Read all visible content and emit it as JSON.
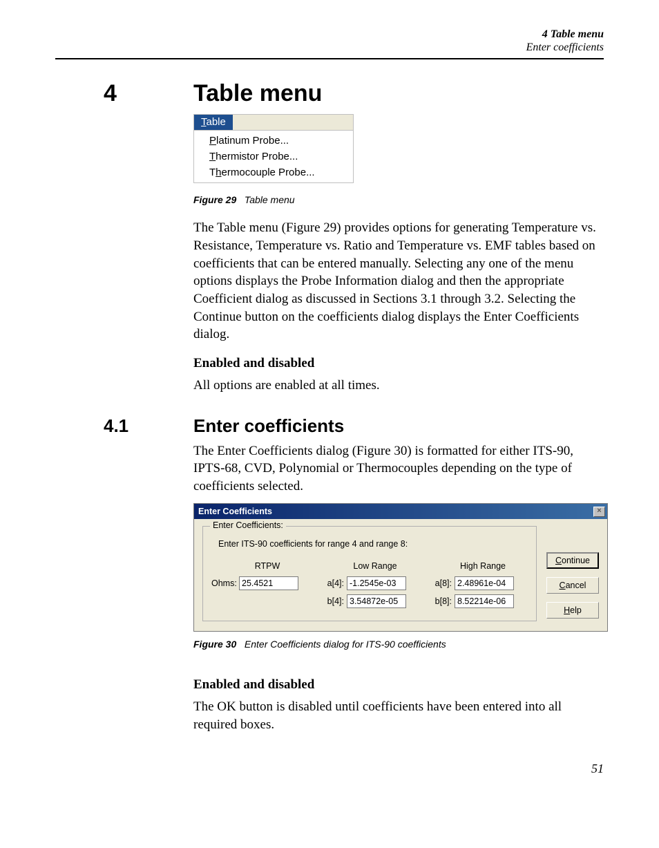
{
  "running_head": {
    "line1": "4  Table menu",
    "line2": "Enter coefficients"
  },
  "section": {
    "num": "4",
    "title": "Table menu"
  },
  "menu": {
    "bar_label": "Table",
    "bar_accel": "T",
    "items": [
      {
        "label": "Platinum Probe...",
        "accel": "P"
      },
      {
        "label": "Thermistor Probe...",
        "accel": "T"
      },
      {
        "label": "Thermocouple Probe...",
        "accel": "h"
      }
    ]
  },
  "fig29": {
    "label": "Figure 29",
    "caption": "Table menu"
  },
  "para1": "The Table menu (Figure 29) provides options for generating Temperature vs. Resistance, Temperature vs. Ratio and Temperature vs. EMF tables based on coefficients that can be entered manually. Selecting any one of the menu options displays the Probe Information dialog and then the appropriate Coefficient dialog as discussed in Sections 3.1 through 3.2. Selecting the Continue button on the coefficients dialog displays the Enter Coefficients dialog.",
  "enabled1_head": "Enabled and disabled",
  "enabled1_body": "All options are enabled at all times.",
  "subsection": {
    "num": "4.1",
    "title": "Enter coefficients"
  },
  "para2": "The Enter Coefficients dialog (Figure 30) is formatted for either ITS-90, IPTS-68, CVD, Polynomial or Thermocouples depending on the type of coefficients selected.",
  "dialog": {
    "title": "Enter Coefficients",
    "group_title": "Enter Coefficients:",
    "desc": "Enter ITS-90 coefficients for range 4 and range 8:",
    "col_headers": {
      "rtpw": "RTPW",
      "low": "Low Range",
      "high": "High Range"
    },
    "labels": {
      "ohms": "Ohms:",
      "a4": "a[4]:",
      "b4": "b[4]:",
      "a8": "a[8]:",
      "b8": "b[8]:"
    },
    "values": {
      "ohms": "25.4521",
      "a4": "-1.2545e-03",
      "b4": "3.54872e-05",
      "a8": "2.48961e-04",
      "b8": "8.52214e-06"
    },
    "buttons": {
      "continue": "Continue",
      "cancel": "Cancel",
      "help": "Help"
    }
  },
  "fig30": {
    "label": "Figure 30",
    "caption": "Enter Coefficients dialog for ITS-90 coefficients"
  },
  "enabled2_head": "Enabled and disabled",
  "enabled2_body": "The OK button is disabled until coefficients have been entered into all required boxes.",
  "page_number": "51"
}
